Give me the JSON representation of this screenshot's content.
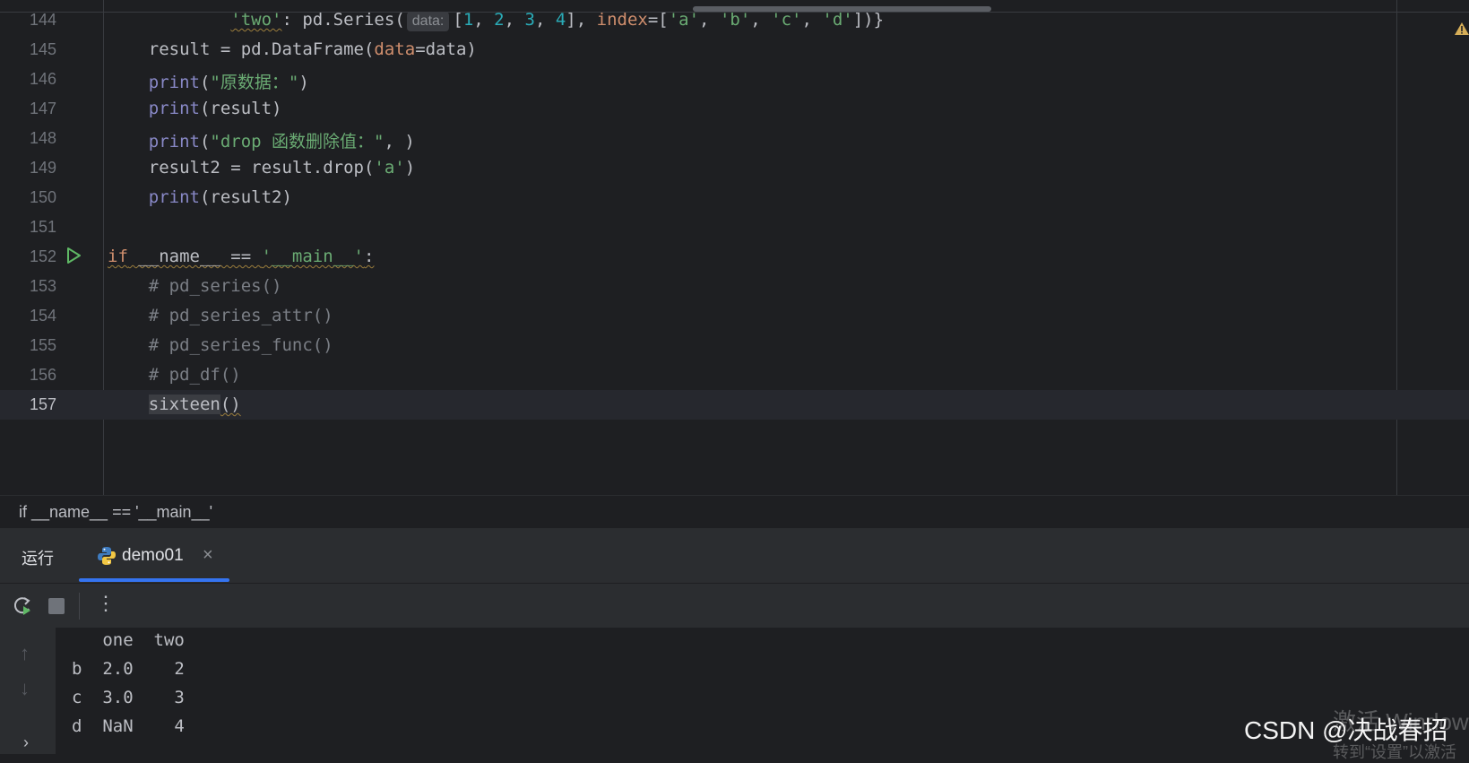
{
  "editor": {
    "lines": [
      {
        "n": "144",
        "tokens": [
          {
            "t": "            ",
            "c": ""
          },
          {
            "t": "'two'",
            "c": "str squiggle"
          },
          {
            "t": ": pd.Series(",
            "c": ""
          },
          {
            "t": "data:",
            "c": "hint"
          },
          {
            "t": "[",
            "c": ""
          },
          {
            "t": "1",
            "c": "num"
          },
          {
            "t": ", ",
            "c": ""
          },
          {
            "t": "2",
            "c": "num"
          },
          {
            "t": ", ",
            "c": ""
          },
          {
            "t": "3",
            "c": "num"
          },
          {
            "t": ", ",
            "c": ""
          },
          {
            "t": "4",
            "c": "num"
          },
          {
            "t": "], ",
            "c": ""
          },
          {
            "t": "index",
            "c": "param"
          },
          {
            "t": "=[",
            "c": ""
          },
          {
            "t": "'a'",
            "c": "str"
          },
          {
            "t": ", ",
            "c": ""
          },
          {
            "t": "'b'",
            "c": "str"
          },
          {
            "t": ", ",
            "c": ""
          },
          {
            "t": "'c'",
            "c": "str"
          },
          {
            "t": ", ",
            "c": ""
          },
          {
            "t": "'d'",
            "c": "str"
          },
          {
            "t": "])}",
            "c": ""
          }
        ]
      },
      {
        "n": "145",
        "tokens": [
          {
            "t": "    result = pd.DataFrame(",
            "c": ""
          },
          {
            "t": "data",
            "c": "param"
          },
          {
            "t": "=data)",
            "c": ""
          }
        ]
      },
      {
        "n": "146",
        "tokens": [
          {
            "t": "    ",
            "c": ""
          },
          {
            "t": "print",
            "c": "builtin"
          },
          {
            "t": "(",
            "c": ""
          },
          {
            "t": "\"原数据：\"",
            "c": "str"
          },
          {
            "t": ")",
            "c": ""
          }
        ]
      },
      {
        "n": "147",
        "tokens": [
          {
            "t": "    ",
            "c": ""
          },
          {
            "t": "print",
            "c": "builtin"
          },
          {
            "t": "(result)",
            "c": ""
          }
        ]
      },
      {
        "n": "148",
        "tokens": [
          {
            "t": "    ",
            "c": ""
          },
          {
            "t": "print",
            "c": "builtin"
          },
          {
            "t": "(",
            "c": ""
          },
          {
            "t": "\"drop 函数删除值：\"",
            "c": "str"
          },
          {
            "t": ", )",
            "c": ""
          }
        ]
      },
      {
        "n": "149",
        "tokens": [
          {
            "t": "    result2 = result.drop(",
            "c": ""
          },
          {
            "t": "'a'",
            "c": "str"
          },
          {
            "t": ")",
            "c": ""
          }
        ]
      },
      {
        "n": "150",
        "tokens": [
          {
            "t": "    ",
            "c": ""
          },
          {
            "t": "print",
            "c": "builtin"
          },
          {
            "t": "(result2)",
            "c": ""
          }
        ]
      },
      {
        "n": "151",
        "tokens": []
      },
      {
        "n": "152",
        "run": true,
        "tokens": [
          {
            "t": "if",
            "c": "kw squiggle"
          },
          {
            "t": " __name__ == ",
            "c": "squiggle"
          },
          {
            "t": "'__main__'",
            "c": "str squiggle"
          },
          {
            "t": ":",
            "c": "squiggle"
          }
        ]
      },
      {
        "n": "153",
        "tokens": [
          {
            "t": "    ",
            "c": ""
          },
          {
            "t": "# pd_series()",
            "c": "cmt"
          }
        ]
      },
      {
        "n": "154",
        "tokens": [
          {
            "t": "    ",
            "c": ""
          },
          {
            "t": "# pd_series_attr()",
            "c": "cmt"
          }
        ]
      },
      {
        "n": "155",
        "tokens": [
          {
            "t": "    ",
            "c": ""
          },
          {
            "t": "# pd_series_func()",
            "c": "cmt"
          }
        ]
      },
      {
        "n": "156",
        "tokens": [
          {
            "t": "    ",
            "c": ""
          },
          {
            "t": "# pd_df()",
            "c": "cmt"
          }
        ]
      },
      {
        "n": "157",
        "current": true,
        "tokens": [
          {
            "t": "    ",
            "c": ""
          },
          {
            "t": "sixteen",
            "c": "hl"
          },
          {
            "t": "()",
            "c": "squiggle"
          }
        ]
      }
    ]
  },
  "breadcrumb": "if __name__ == '__main__'",
  "run_panel": {
    "title": "运行",
    "tab_label": "demo01",
    "tab_close": "×",
    "more": "⋮"
  },
  "console": {
    "lines": [
      "   one  two",
      "b  2.0    2",
      "c  3.0    3",
      "d  NaN    4"
    ]
  },
  "icons": {
    "rerun": "rerun-icon",
    "stop": "stop-icon",
    "up": "↑",
    "down": "↓",
    "expand": "›"
  },
  "watermarks": {
    "csdn": "CSDN @决战春招",
    "windows_line1": "激活 Windows",
    "windows_line2": "转到“设置”以激活"
  }
}
